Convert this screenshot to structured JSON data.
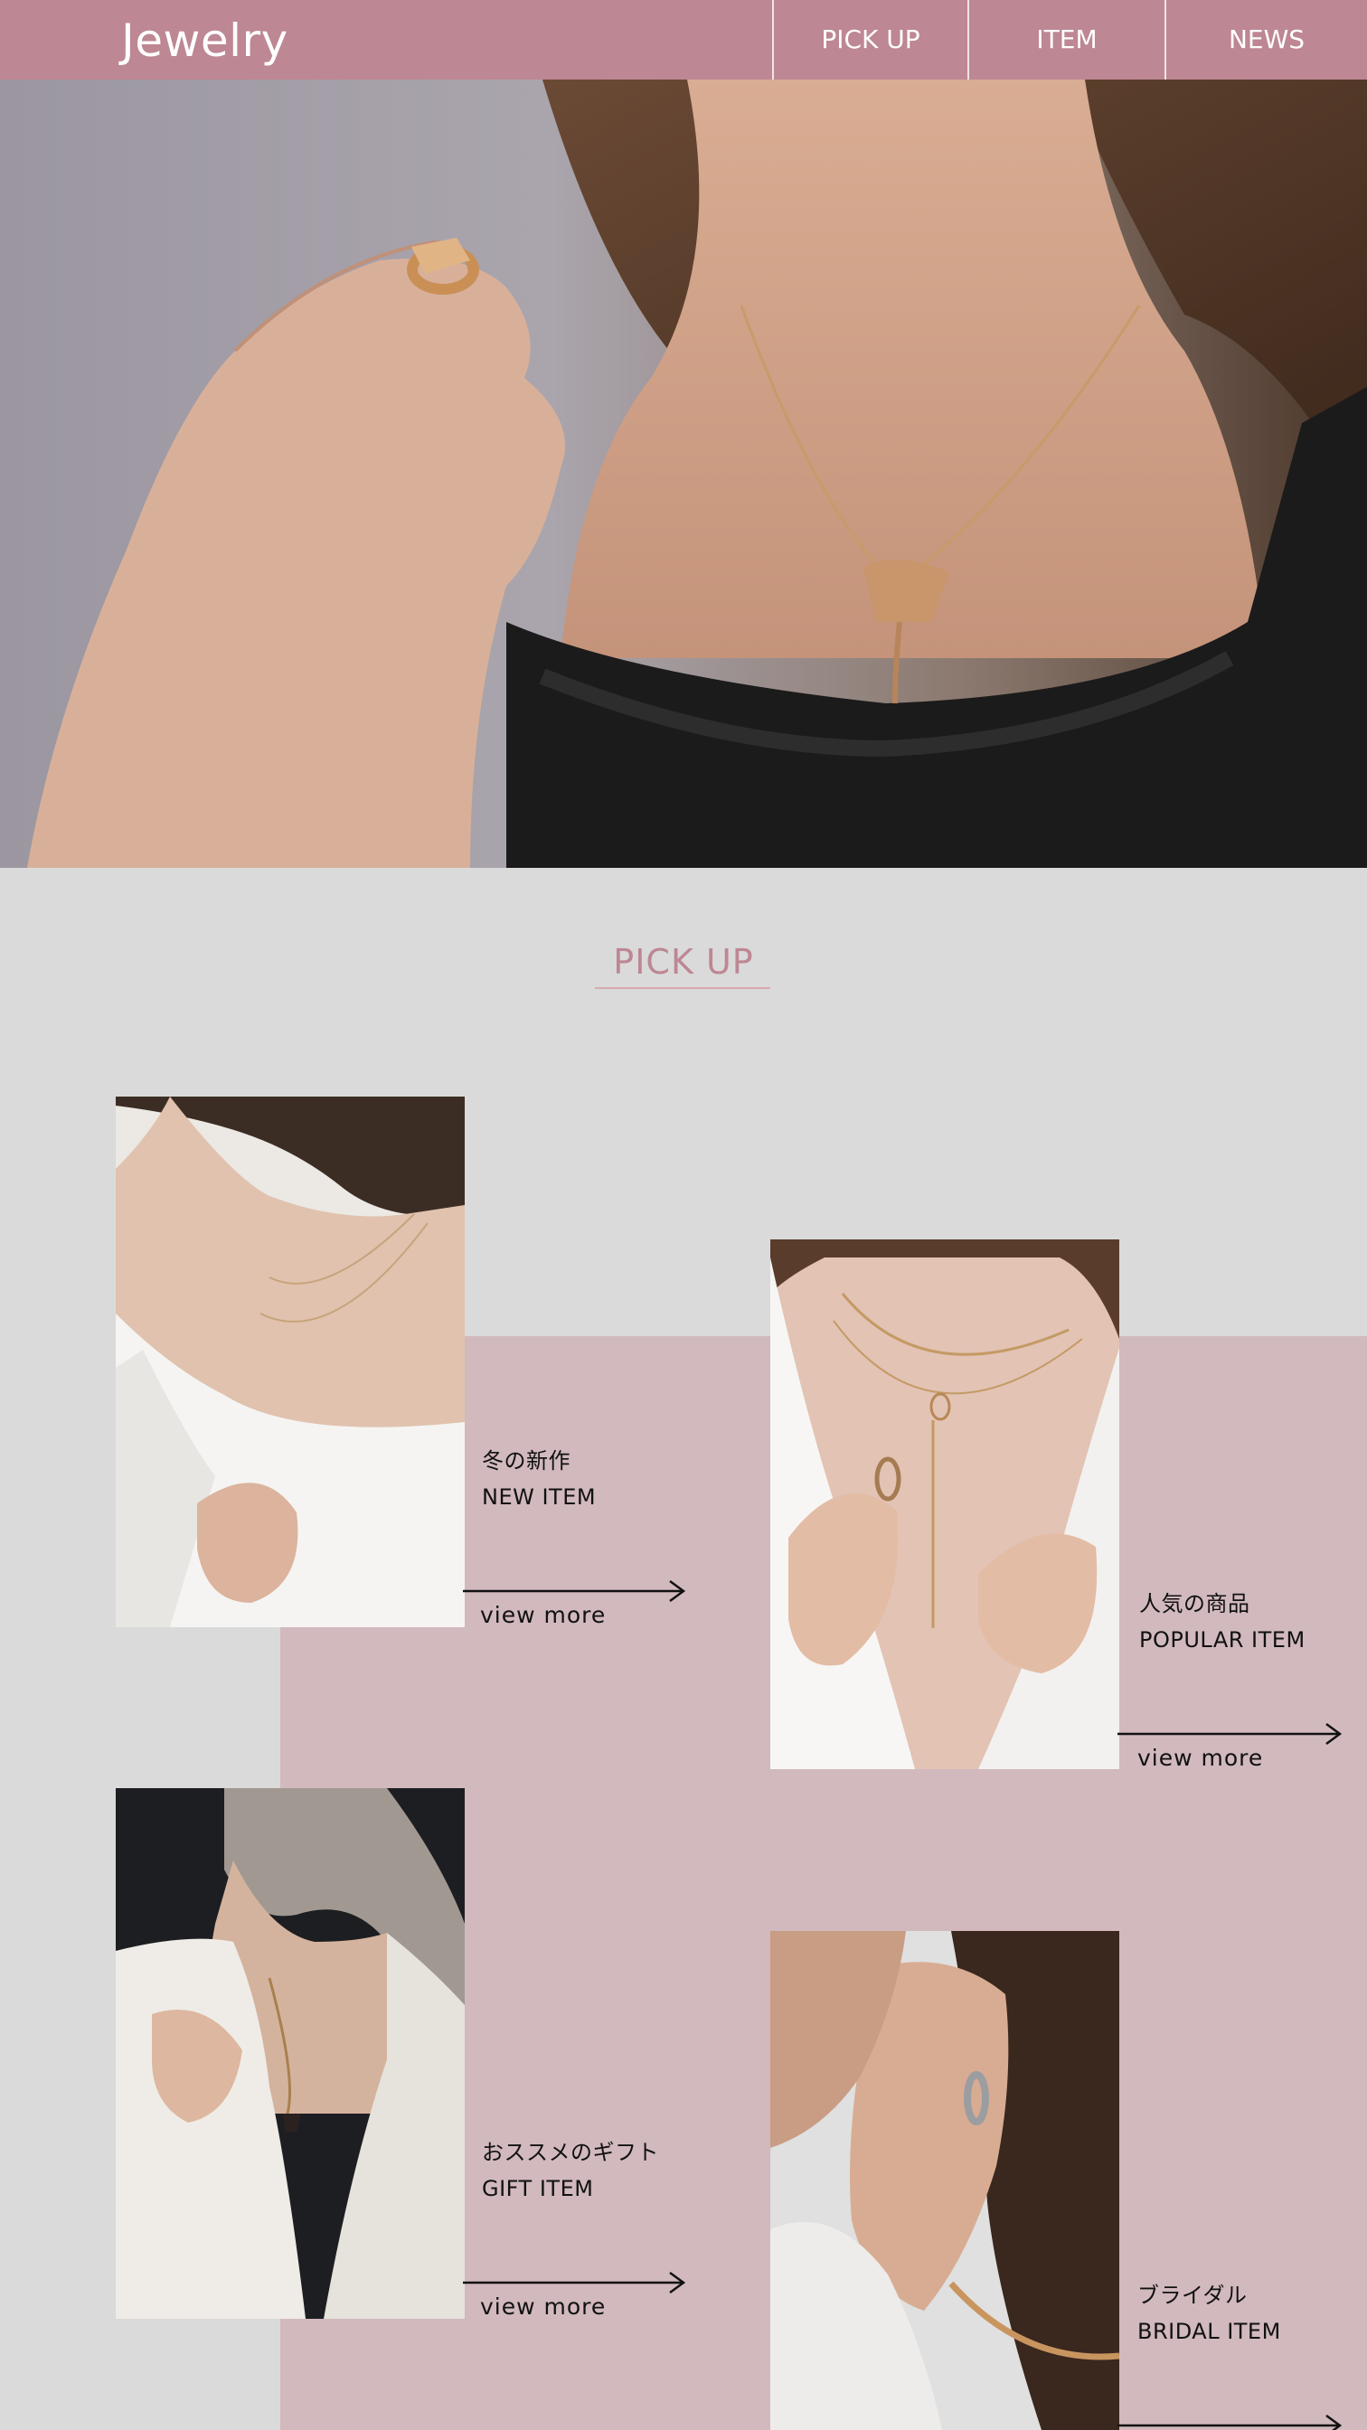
{
  "header": {
    "logo": "Jewelry",
    "nav": [
      "PICK UP",
      "ITEM",
      "NEWS"
    ]
  },
  "pickup": {
    "title": "PICK UP",
    "items": [
      {
        "jp": "冬の新作",
        "en": "NEW ITEM",
        "link": "view more"
      },
      {
        "jp": "人気の商品",
        "en": "POPULAR ITEM",
        "link": "view more"
      },
      {
        "jp": "おススメのギフト",
        "en": "GIFT ITEM",
        "link": "view more"
      },
      {
        "jp": "ブライダル",
        "en": "BRIDAL ITEM",
        "link": ""
      }
    ]
  },
  "colors": {
    "header_bg": "#bd8793",
    "accent": "#bd8793",
    "band": "#d1b9be",
    "page_bg": "#dadada"
  }
}
